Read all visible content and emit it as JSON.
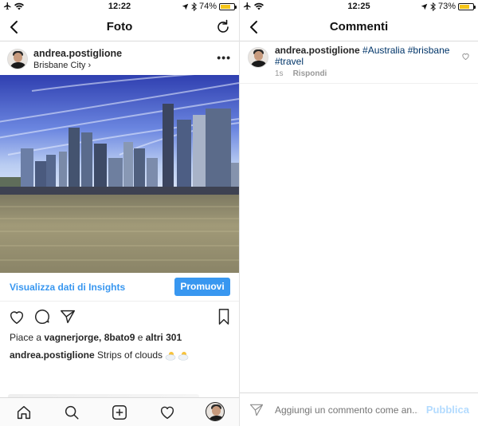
{
  "left": {
    "status": {
      "time": "12:22",
      "battery": "74%",
      "battery_level": 0.74
    },
    "nav": {
      "title": "Foto"
    },
    "post": {
      "username": "andrea.postiglione",
      "location": "Brisbane City",
      "location_chevron": "›",
      "more": "•••",
      "insights_link": "Visualizza dati di Insights",
      "promote_button": "Promuovi",
      "likes_prefix": "Piace a ",
      "likes_users": "vagnerjorge, 8bato9",
      "likes_mid": " e ",
      "likes_others": "altri 301",
      "caption_user": "andrea.postiglione",
      "caption_text": " Strips of clouds"
    }
  },
  "right": {
    "status": {
      "time": "12:25",
      "battery": "73%",
      "battery_level": 0.73
    },
    "nav": {
      "title": "Commenti"
    },
    "comment": {
      "username": "andrea.postiglione",
      "hashtag1": "#Australia",
      "hashtag2": "#brisbane",
      "hashtag3": "#travel",
      "age": "1s",
      "reply": "Rispondi"
    },
    "composer": {
      "placeholder": "Aggiungi un commento come an...",
      "publish": "Pubblica"
    }
  },
  "colors": {
    "accent": "#3897f0",
    "hashtag": "#003569",
    "battery": "#f5c518"
  }
}
